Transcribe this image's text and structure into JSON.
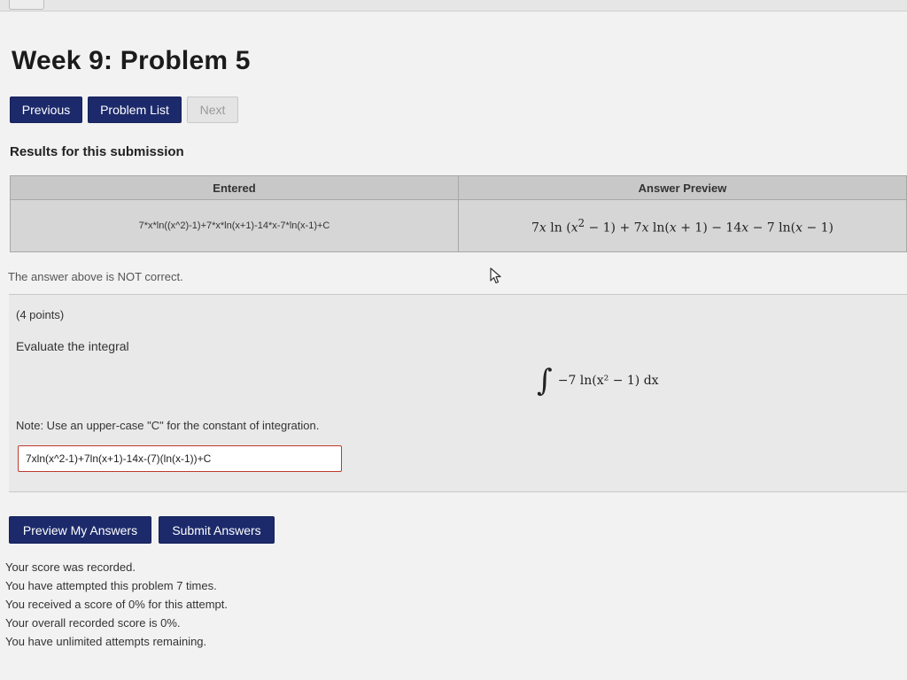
{
  "page": {
    "title": "Week 9: Problem 5"
  },
  "nav": {
    "previous_label": "Previous",
    "problem_list_label": "Problem List",
    "next_label": "Next"
  },
  "results": {
    "heading": "Results for this submission",
    "columns": [
      "Entered",
      "Answer Preview"
    ],
    "entered": "7*x*ln((x^2)-1)+7*x*ln(x+1)-14*x-7*ln(x-1)+C",
    "preview": {
      "a": "7",
      "x": "x",
      "ln": "ln",
      "sq": "2",
      "t1": "(",
      "t1b": " − 1) + 7",
      "t2": " ln(",
      "t2b": " + 1) − 14",
      "t3": " − 7 ln(",
      "t3b": " − 1)"
    },
    "status_message": "The answer above is NOT correct."
  },
  "problem": {
    "points": "(4 points)",
    "prompt": "Evaluate the integral",
    "integral_sign": "∫",
    "integrand": "−7 ln(x² − 1) dx",
    "note": "Note: Use an upper-case \"C\" for the constant of integration.",
    "answer_value": "7xln(x^2-1)+7ln(x+1)-14x-(7)(ln(x-1))+C"
  },
  "actions": {
    "preview_label": "Preview My Answers",
    "submit_label": "Submit Answers"
  },
  "score": {
    "messages": [
      "Your score was recorded.",
      "You have attempted this problem 7 times.",
      "You received a score of 0% for this attempt.",
      "Your overall recorded score is 0%.",
      "You have unlimited attempts remaining."
    ]
  },
  "colors": {
    "button": "#1c2a6b",
    "input_border_error": "#c0392b"
  }
}
